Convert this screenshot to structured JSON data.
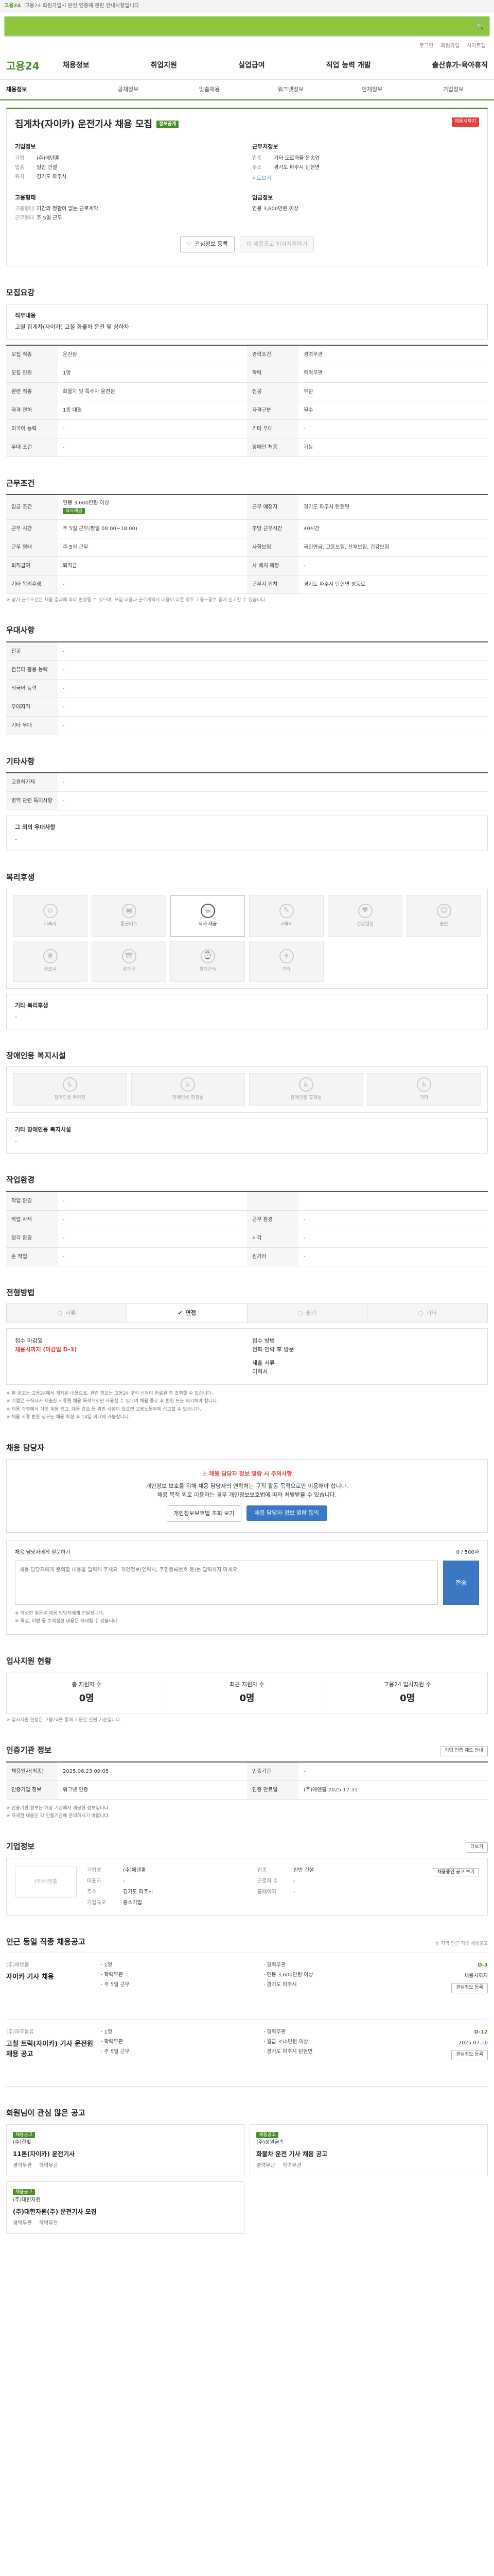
{
  "topbar": {
    "brand": "고용24",
    "notice": "고용24 회원가입시 본인 인증에 관련 안내사항입니다"
  },
  "util": [
    "로그인",
    "회원가입",
    "사이트맵"
  ],
  "gnb": {
    "logo": "고용24",
    "menu": [
      "채용정보",
      "취업지원",
      "실업급여",
      "직업 능력 개발",
      "출산휴가·육아휴직"
    ]
  },
  "lnb": [
    "채용정보",
    "공채정보",
    "맞춤채용",
    "워크넷정보",
    "인재정보",
    "기업정보"
  ],
  "title": {
    "text": "집게차(자이카) 운전기사 채용 모집",
    "tag": "정보공개",
    "dday": "채용시까지"
  },
  "corp": {
    "heading": "기업정보",
    "rows": [
      {
        "k": "기업",
        "v": "(주)에덴홀"
      },
      {
        "k": "업종",
        "v": "일반 건설"
      },
      {
        "k": "위치",
        "v": "경기도 파주시"
      }
    ]
  },
  "workplace": {
    "heading": "근무처정보",
    "rows": [
      {
        "k": "업종",
        "v": "기타 도로화물 운송업"
      },
      {
        "k": "주소",
        "v": "경기도 파주시 탄현면"
      }
    ],
    "link": "지도보기"
  },
  "employ": {
    "heading": "고용형태",
    "rows": [
      {
        "k": "고용형태",
        "v": "기간의 정함이 없는 근로계약"
      },
      {
        "k": "근무형태",
        "v": "주 5일 근무"
      }
    ]
  },
  "wage": {
    "heading": "임금정보",
    "v": "연봉 3,600만원 이상"
  },
  "actions": {
    "scrap": "관심정보 등록",
    "apply": "이 채용공고 입사지원하기"
  },
  "s1": {
    "title": "모집요강",
    "jobtitle": "직무내용",
    "jobdesc": "고철 집게차(자이카) 고철 화물차 운전 및 상하차",
    "rows": [
      [
        "모집 직종",
        "운전원",
        "경력조건",
        "경력무관"
      ],
      [
        "모집 인원",
        "1명",
        "학력",
        "학력무관"
      ],
      [
        "관련 직종",
        "화물차 및 특수차 운전원",
        "전공",
        "무관"
      ],
      [
        "자격 면허",
        "1종 대형",
        "자격구분",
        "필수"
      ],
      [
        "외국어 능력",
        "-",
        "기타 우대",
        "-"
      ],
      [
        "우대 조건",
        "-",
        "장애인 채용",
        "가능"
      ]
    ]
  },
  "s2": {
    "title": "근무조건",
    "wage_label": "임금 조건",
    "wage_value": "연봉 3,600만원 이상",
    "meal": "식사제공",
    "region_label": "근무 예정지",
    "region_value": "경기도 파주시 탄현면",
    "hours_label": "근무 시간",
    "hours_value": "주 5일 근무(평일 08:00~18:00)",
    "week_label": "주당 근무시간",
    "week_value": "40시간",
    "rows": [
      [
        "근무 형태",
        "주 5일 근무",
        "사회보험",
        "국민연금, 고용보험, 산재보험, 건강보험"
      ],
      [
        "퇴직급여",
        "퇴직금",
        "사 배치 예정",
        "-"
      ],
      [
        "기타 복리후생",
        "-",
        "근무지 위치",
        "경기도 파주시 탄현면 성동로"
      ]
    ],
    "notice": "※ 상기 근로조건은 채용 결과에 따라 변경될 수 있으며, 모집 내용과 근로계약서 내용이 다른 경우 고용노동부 등에 신고할 수 있습니다."
  },
  "s3": {
    "title": "우대사항",
    "rows": [
      [
        "전공",
        "-"
      ],
      [
        "컴퓨터 활용 능력",
        "-"
      ],
      [
        "외국어 능력",
        "-"
      ],
      [
        "우대자격",
        "-"
      ],
      [
        "기타 우대",
        "-"
      ]
    ]
  },
  "s4": {
    "title": "기타사항",
    "rows": [
      [
        "고용허가제",
        "-"
      ],
      [
        "병역 관련 특이사항",
        "-"
      ]
    ],
    "etc": "그 외의 우대사항",
    "etcv": "-"
  },
  "s5": {
    "title": "복리후생",
    "cards": [
      {
        "icon": "home",
        "label": "기숙사"
      },
      {
        "icon": "car",
        "label": "통근버스"
      },
      {
        "icon": "meal",
        "label": "식사 제공"
      },
      {
        "icon": "school",
        "label": "교육비"
      },
      {
        "icon": "heart",
        "label": "건강검진"
      },
      {
        "icon": "child",
        "label": "출산"
      },
      {
        "icon": "gift",
        "label": "경조사"
      },
      {
        "icon": "money",
        "label": "성과급"
      },
      {
        "icon": "clock",
        "label": "장기근속"
      },
      {
        "icon": "plus",
        "label": "기타"
      }
    ],
    "active": "식사 제공",
    "box_t": "기타 복리후생",
    "box_v": "-"
  },
  "s6": {
    "title": "장애인용 복지시설",
    "cards": [
      "장애인용 주차장",
      "장애인용 화장실",
      "장애인용 휴게실",
      "기타"
    ],
    "box_t": "기타 장애인용 복지시설",
    "box_v": "-"
  },
  "s7": {
    "title": "작업환경",
    "rows": [
      [
        "작업 환경",
        "-",
        "",
        ""
      ],
      [
        "작업 자세",
        "-",
        "근무 환경",
        "-"
      ],
      [
        "청각 환경",
        "-",
        "시각",
        "-"
      ],
      [
        "손 작업",
        "-",
        "원거리",
        "-"
      ]
    ]
  },
  "s8": {
    "title": "전형방법",
    "tabs": [
      "서류",
      "면접",
      "필기",
      "기타"
    ],
    "active": "면접",
    "deadline_l": "접수 마감일",
    "deadline_v": "채용시까지 (마감일 D-3)",
    "method_l": "접수 방법",
    "method_v": "전화 연락 후 방문",
    "doc_l": "제출 서류",
    "doc_v": "이력서",
    "notes": [
      "※ 본 공고는 고용24에서 게재된 내용으로, 관련 정보는 고용24 구직 신청이 완료된 후 조회할 수 있습니다.",
      "※ 기업은 구직자가 제출한 서류를 채용 목적으로만 사용할 수 있으며 채용 종료 후 반환 또는 폐기해야 합니다.",
      "※ 채용 과정에서 거짓 채용 광고, 채용 강요 등 위반 사항이 있으면 고용노동부에 신고할 수 있습니다.",
      "※ 채용 서류 반환 청구는 채용 확정 후 14일 이내에 가능합니다."
    ]
  },
  "s9": {
    "title": "채용 담당자",
    "alert": "채용 담당자 정보 열람 시 주의사항",
    "msg": "개인정보 보호를 위해 채용 담당자의 연락처는 구직 활동 목적으로만 이용해야 합니다.",
    "msg2": "채용 목적 외로 이용하는 경우 개인정보보호법에 따라 처벌받을 수 있습니다.",
    "btn1": "개인정보보호법 조회 보기",
    "btn2": "채용 담당자 정보 열람 동의"
  },
  "q": {
    "title": "채용 담당자에게 질문하기",
    "count": "0 / 500자",
    "placeholder": "채용 담당자에게 문의할 내용을 입력해 주세요. 개인정보(연락처, 주민등록번호 등)는 입력하지 마세요.",
    "send": "전송",
    "notes": [
      "※ 작성한 질문은 채용 담당자에게 전달됩니다.",
      "※ 욕설, 비방 등 부적절한 내용은 삭제될 수 있습니다."
    ]
  },
  "s10": {
    "title": "입사지원 현황",
    "stats": [
      {
        "l": "총 지원자 수",
        "v": "0명"
      },
      {
        "l": "최근 지원자 수",
        "v": "0명"
      },
      {
        "l": "고용24 입사지원 수",
        "v": "0명"
      }
    ],
    "note": "※ 입사지원 현황은 고용24를 통해 지원한 인원 기준입니다."
  },
  "s11": {
    "title": "인증기관 정보",
    "btn": "기업 인증 제도 안내",
    "rows": [
      [
        "채용일자(최종)",
        "2025.06.23 09:05",
        "인증기관",
        "-"
      ],
      [
        "인증기업 정보",
        "워크넷 인증",
        "인증 만료일",
        "(주)에덴홀 2025.12.31"
      ]
    ],
    "notes": [
      "※ 인증기관 정보는 해당 기관에서 제공한 정보입니다.",
      "※ 자세한 내용은 각 인증기관에 문의하시기 바랍니다."
    ]
  },
  "s12": {
    "title": "기업정보",
    "more": "더보기",
    "logo": "(주)에덴홀",
    "info": [
      [
        "기업명",
        "(주)에덴홀",
        "업종",
        "일반 건설"
      ],
      [
        "대표자",
        "-",
        "근로자 수",
        "-"
      ],
      [
        "주소",
        "경기도 파주시",
        "홈페이지",
        "-"
      ],
      [
        "기업규모",
        "중소기업",
        "",
        ""
      ]
    ],
    "btn": "채용중인 공고 보기"
  },
  "s13": {
    "title": "인근 동일 직종 채용공고",
    "more": "동 지역 인근 직종 채용공고",
    "items": [
      {
        "co": "(주)에덴홀",
        "title": "자이카 기사 채용",
        "meta": [
          "1명",
          "경력무관",
          "학력무관",
          "연봉 3,600만원 이상",
          "주 5일 근무",
          "경기도 파주시"
        ],
        "dd": "D-3",
        "deadline": "채용시까지"
      },
      {
        "co": "(주)파주물류",
        "title": "고철 트럭(자이카) 기사 운전원 채용 공고",
        "meta": [
          "1명",
          "경력무관",
          "학력무관",
          "월급 350만원 이상",
          "주 5일 근무",
          "경기도 파주시 탄현면"
        ],
        "dd": "D-12",
        "deadline": "2025.07.10"
      }
    ]
  },
  "s14": {
    "title": "회원님이 관심 많은 공고",
    "items": [
      {
        "tag": "채용공고",
        "co": "(주)한빛",
        "title": "11톤(자이카) 운전기사",
        "meta": [
          "경력무관",
          "학력무관"
        ]
      },
      {
        "tag": "채용공고",
        "co": "(주)성원금속",
        "title": "화물차 운전 기사 채용 공고",
        "meta": [
          "경력무관",
          "학력무관"
        ]
      },
      {
        "tag": "채용공고",
        "co": "(주)대한자원",
        "title": "(주)대한자원(주) 운전기사 모집",
        "meta": [
          "경력무관",
          "학력무관"
        ]
      }
    ]
  }
}
